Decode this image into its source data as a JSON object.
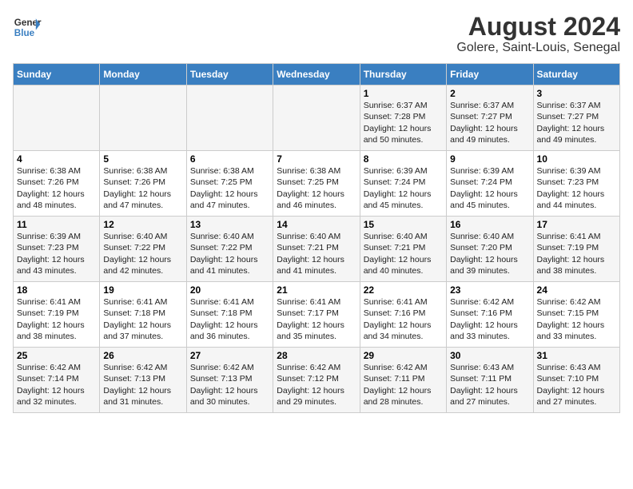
{
  "header": {
    "logo_line1": "General",
    "logo_line2": "Blue",
    "title": "August 2024",
    "subtitle": "Golere, Saint-Louis, Senegal"
  },
  "days_of_week": [
    "Sunday",
    "Monday",
    "Tuesday",
    "Wednesday",
    "Thursday",
    "Friday",
    "Saturday"
  ],
  "weeks": [
    [
      {
        "day": "",
        "sunrise": "",
        "sunset": "",
        "daylight": ""
      },
      {
        "day": "",
        "sunrise": "",
        "sunset": "",
        "daylight": ""
      },
      {
        "day": "",
        "sunrise": "",
        "sunset": "",
        "daylight": ""
      },
      {
        "day": "",
        "sunrise": "",
        "sunset": "",
        "daylight": ""
      },
      {
        "day": "1",
        "sunrise": "Sunrise: 6:37 AM",
        "sunset": "Sunset: 7:28 PM",
        "daylight": "Daylight: 12 hours and 50 minutes."
      },
      {
        "day": "2",
        "sunrise": "Sunrise: 6:37 AM",
        "sunset": "Sunset: 7:27 PM",
        "daylight": "Daylight: 12 hours and 49 minutes."
      },
      {
        "day": "3",
        "sunrise": "Sunrise: 6:37 AM",
        "sunset": "Sunset: 7:27 PM",
        "daylight": "Daylight: 12 hours and 49 minutes."
      }
    ],
    [
      {
        "day": "4",
        "sunrise": "Sunrise: 6:38 AM",
        "sunset": "Sunset: 7:26 PM",
        "daylight": "Daylight: 12 hours and 48 minutes."
      },
      {
        "day": "5",
        "sunrise": "Sunrise: 6:38 AM",
        "sunset": "Sunset: 7:26 PM",
        "daylight": "Daylight: 12 hours and 47 minutes."
      },
      {
        "day": "6",
        "sunrise": "Sunrise: 6:38 AM",
        "sunset": "Sunset: 7:25 PM",
        "daylight": "Daylight: 12 hours and 47 minutes."
      },
      {
        "day": "7",
        "sunrise": "Sunrise: 6:38 AM",
        "sunset": "Sunset: 7:25 PM",
        "daylight": "Daylight: 12 hours and 46 minutes."
      },
      {
        "day": "8",
        "sunrise": "Sunrise: 6:39 AM",
        "sunset": "Sunset: 7:24 PM",
        "daylight": "Daylight: 12 hours and 45 minutes."
      },
      {
        "day": "9",
        "sunrise": "Sunrise: 6:39 AM",
        "sunset": "Sunset: 7:24 PM",
        "daylight": "Daylight: 12 hours and 45 minutes."
      },
      {
        "day": "10",
        "sunrise": "Sunrise: 6:39 AM",
        "sunset": "Sunset: 7:23 PM",
        "daylight": "Daylight: 12 hours and 44 minutes."
      }
    ],
    [
      {
        "day": "11",
        "sunrise": "Sunrise: 6:39 AM",
        "sunset": "Sunset: 7:23 PM",
        "daylight": "Daylight: 12 hours and 43 minutes."
      },
      {
        "day": "12",
        "sunrise": "Sunrise: 6:40 AM",
        "sunset": "Sunset: 7:22 PM",
        "daylight": "Daylight: 12 hours and 42 minutes."
      },
      {
        "day": "13",
        "sunrise": "Sunrise: 6:40 AM",
        "sunset": "Sunset: 7:22 PM",
        "daylight": "Daylight: 12 hours and 41 minutes."
      },
      {
        "day": "14",
        "sunrise": "Sunrise: 6:40 AM",
        "sunset": "Sunset: 7:21 PM",
        "daylight": "Daylight: 12 hours and 41 minutes."
      },
      {
        "day": "15",
        "sunrise": "Sunrise: 6:40 AM",
        "sunset": "Sunset: 7:21 PM",
        "daylight": "Daylight: 12 hours and 40 minutes."
      },
      {
        "day": "16",
        "sunrise": "Sunrise: 6:40 AM",
        "sunset": "Sunset: 7:20 PM",
        "daylight": "Daylight: 12 hours and 39 minutes."
      },
      {
        "day": "17",
        "sunrise": "Sunrise: 6:41 AM",
        "sunset": "Sunset: 7:19 PM",
        "daylight": "Daylight: 12 hours and 38 minutes."
      }
    ],
    [
      {
        "day": "18",
        "sunrise": "Sunrise: 6:41 AM",
        "sunset": "Sunset: 7:19 PM",
        "daylight": "Daylight: 12 hours and 38 minutes."
      },
      {
        "day": "19",
        "sunrise": "Sunrise: 6:41 AM",
        "sunset": "Sunset: 7:18 PM",
        "daylight": "Daylight: 12 hours and 37 minutes."
      },
      {
        "day": "20",
        "sunrise": "Sunrise: 6:41 AM",
        "sunset": "Sunset: 7:18 PM",
        "daylight": "Daylight: 12 hours and 36 minutes."
      },
      {
        "day": "21",
        "sunrise": "Sunrise: 6:41 AM",
        "sunset": "Sunset: 7:17 PM",
        "daylight": "Daylight: 12 hours and 35 minutes."
      },
      {
        "day": "22",
        "sunrise": "Sunrise: 6:41 AM",
        "sunset": "Sunset: 7:16 PM",
        "daylight": "Daylight: 12 hours and 34 minutes."
      },
      {
        "day": "23",
        "sunrise": "Sunrise: 6:42 AM",
        "sunset": "Sunset: 7:16 PM",
        "daylight": "Daylight: 12 hours and 33 minutes."
      },
      {
        "day": "24",
        "sunrise": "Sunrise: 6:42 AM",
        "sunset": "Sunset: 7:15 PM",
        "daylight": "Daylight: 12 hours and 33 minutes."
      }
    ],
    [
      {
        "day": "25",
        "sunrise": "Sunrise: 6:42 AM",
        "sunset": "Sunset: 7:14 PM",
        "daylight": "Daylight: 12 hours and 32 minutes."
      },
      {
        "day": "26",
        "sunrise": "Sunrise: 6:42 AM",
        "sunset": "Sunset: 7:13 PM",
        "daylight": "Daylight: 12 hours and 31 minutes."
      },
      {
        "day": "27",
        "sunrise": "Sunrise: 6:42 AM",
        "sunset": "Sunset: 7:13 PM",
        "daylight": "Daylight: 12 hours and 30 minutes."
      },
      {
        "day": "28",
        "sunrise": "Sunrise: 6:42 AM",
        "sunset": "Sunset: 7:12 PM",
        "daylight": "Daylight: 12 hours and 29 minutes."
      },
      {
        "day": "29",
        "sunrise": "Sunrise: 6:42 AM",
        "sunset": "Sunset: 7:11 PM",
        "daylight": "Daylight: 12 hours and 28 minutes."
      },
      {
        "day": "30",
        "sunrise": "Sunrise: 6:43 AM",
        "sunset": "Sunset: 7:11 PM",
        "daylight": "Daylight: 12 hours and 27 minutes."
      },
      {
        "day": "31",
        "sunrise": "Sunrise: 6:43 AM",
        "sunset": "Sunset: 7:10 PM",
        "daylight": "Daylight: 12 hours and 27 minutes."
      }
    ]
  ]
}
